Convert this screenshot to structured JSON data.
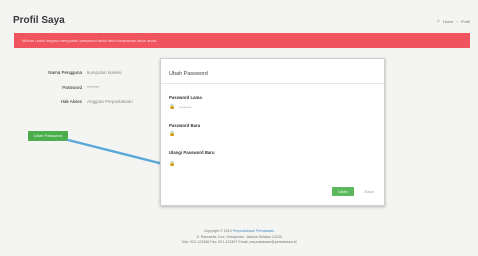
{
  "header": {
    "title": "Profil Saya",
    "breadcrumb": [
      "Home",
      "Profil"
    ]
  },
  "alert": {
    "message": "Mohon untuk segera mengubah password anda demi keamanan akun anda."
  },
  "profile": {
    "rows": [
      {
        "label": "Nama Pengguna",
        "value": "kumpulan koleksi"
      },
      {
        "label": "Password",
        "value": "*******"
      },
      {
        "label": "Hak Akses",
        "value": "Anggota Perpustakaan"
      }
    ],
    "change_password_button": "Ubah Password"
  },
  "modal": {
    "title": "Ubah Password",
    "fields": [
      {
        "label": "Password Lama",
        "value": "********"
      },
      {
        "label": "Password Baru",
        "value": ""
      },
      {
        "label": "Ulangi Password Baru",
        "value": ""
      }
    ],
    "submit_label": "Ubah",
    "cancel_label": "Batal"
  },
  "footer": {
    "copyright_prefix": "Copyright © 2019",
    "copyright_link": "Perpustakaan Perbatasan",
    "address": "Jl. Pancasila, Kec. Kebayoran, Jakarta Selatan 12240",
    "contact": "Telp: 021-123456 Fax: 021-123457 Email: perpustakaan@perbatasan.id"
  },
  "colors": {
    "alert": "#f0545f",
    "primary_button": "#4cae4c",
    "arrow": "#5aa9d8",
    "link": "#4a8ec4"
  }
}
